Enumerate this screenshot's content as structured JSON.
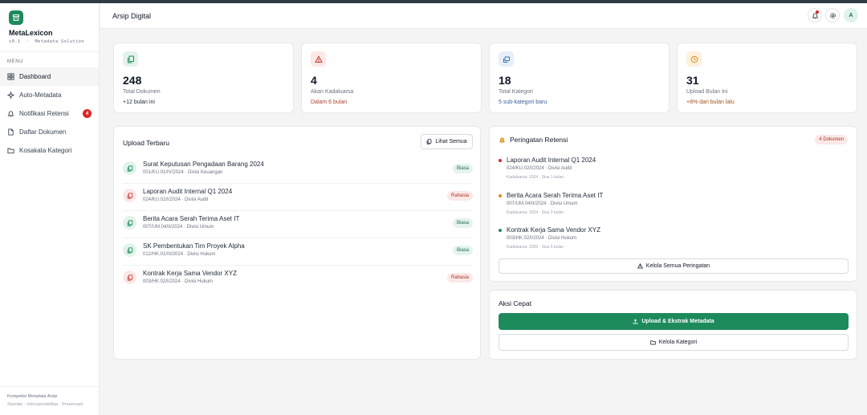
{
  "app": {
    "name": "MetaLexicon",
    "version": "v0.1",
    "tagline": "Metadata Solution"
  },
  "sidebar": {
    "menu_label": "MENU",
    "items": [
      {
        "label": "Dashboard",
        "icon": "dashboard-icon",
        "active": true
      },
      {
        "label": "Auto-Metadata",
        "icon": "sparkle-icon"
      },
      {
        "label": "Notifikasi Retensi",
        "icon": "bell-icon",
        "badge": "4"
      },
      {
        "label": "Daftar Dokumen",
        "icon": "document-icon"
      },
      {
        "label": "Kosakata Kategori",
        "icon": "folder-icon"
      }
    ],
    "footer_line1": "Kompetisi Metadata Arsip",
    "footer_line2": "Standar · Interoperabilitas · Preservasi"
  },
  "header": {
    "title": "Arsip Digital",
    "avatar_initial": "A"
  },
  "stats": [
    {
      "value": "248",
      "label": "Total Dokumen",
      "sub": "+12 bulan ini",
      "icon": "documents-icon",
      "accent": "#1d8a5c",
      "tint": "#e2f3ea",
      "sub_color": "#1f2937"
    },
    {
      "value": "4",
      "label": "Akan Kadaluarsa",
      "sub": "Dalam 6 bulan",
      "icon": "warning-icon",
      "accent": "#c2413a",
      "tint": "#fce8e6",
      "sub_color": "#b0432f"
    },
    {
      "value": "18",
      "label": "Total Kategori",
      "sub": "5 sub-kategori baru",
      "icon": "layers-icon",
      "accent": "#3b6fb6",
      "tint": "#e6eef9",
      "sub_color": "#3b5f9e"
    },
    {
      "value": "31",
      "label": "Upload Bulan Ini",
      "sub": "+8% dari bulan lalu",
      "icon": "clock-icon",
      "accent": "#d98a1a",
      "tint": "#fdf0dc",
      "sub_color": "#a1521b"
    }
  ],
  "recent": {
    "title": "Upload Terbaru",
    "view_all_label": "Lihat Semua",
    "items": [
      {
        "title": "Surat Keputusan Pengadaan Barang 2024",
        "meta": "001/KU.01/IV/2024 · Divisi Keuangan",
        "tag": "Biasa"
      },
      {
        "title": "Laporan Audit Internal Q1 2024",
        "meta": "024/KU.02/I/2024 · Divisi Audit",
        "tag": "Rahasia"
      },
      {
        "title": "Berita Acara Serah Terima Aset IT",
        "meta": "007/UM.04/II/2024 · Divisi Umum",
        "tag": "Biasa"
      },
      {
        "title": "SK Pembentukan Tim Proyek Alpha",
        "meta": "012/HK.01/III/2024 · Divisi Hukum",
        "tag": "Biasa"
      },
      {
        "title": "Kontrak Kerja Sama Vendor XYZ",
        "meta": "003/HK.02/I/2024 · Divisi Hukum",
        "tag": "Rahasia"
      }
    ]
  },
  "retention": {
    "title": "Peringatan Retensi",
    "badge": "4 Dokumen",
    "items": [
      {
        "title": "Laporan Audit Internal Q1 2024",
        "meta": "024/KU.02/I/2024 · Divisi Audit",
        "due": "Kadaluarsa: 2024 · Sisa 1 bulan",
        "color": "#dc2626"
      },
      {
        "title": "Berita Acara Serah Terima Aset IT",
        "meta": "007/UM.04/II/2024 · Divisi Umum",
        "due": "Kadaluarsa: 2024 · Sisa 3 bulan",
        "color": "#e08a1e"
      },
      {
        "title": "Kontrak Kerja Sama Vendor XYZ",
        "meta": "003/HK.02/I/2024 · Divisi Hukum",
        "due": "Kadaluarsa: 2025 · Sisa 5 bulan",
        "color": "#1d8a5c"
      }
    ],
    "manage_label": "Kelola Semua Peringatan"
  },
  "quick": {
    "title": "Aksi Cepat",
    "primary_label": "Upload & Ekstrak Metadata",
    "secondary_label": "Kelola Kategori"
  }
}
